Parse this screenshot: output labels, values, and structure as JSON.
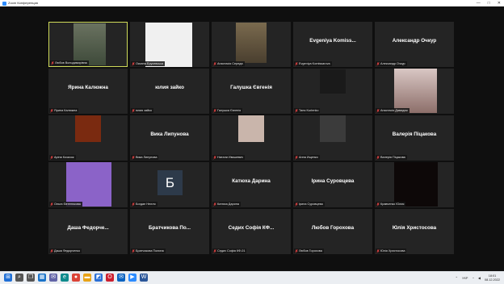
{
  "window": {
    "title": "Zoom Конференция",
    "controls": {
      "minimize": "—",
      "maximize": "□",
      "close": "✕"
    }
  },
  "tiles": [
    {
      "name": "",
      "label": "Любов Володимирівна",
      "speaking": true,
      "photo": "lyubov"
    },
    {
      "name": "",
      "label": "Оксана Ерусевська",
      "photo": "oksana"
    },
    {
      "name": "",
      "label": "Анастасія Середа",
      "photo": "anastasia1"
    },
    {
      "name": "Evgeniya Komiss...",
      "label": "Evgeniya Komissarova"
    },
    {
      "name": "Александр Очкур",
      "label": "Александр Очкур"
    },
    {
      "name": "Ярина Калюжна",
      "label": "Ярина Калюжна"
    },
    {
      "name": "юлия зайко",
      "label": "юлия зайко"
    },
    {
      "name": "Галушка Євгенія",
      "label": "Галушка Євгенія"
    },
    {
      "name": "",
      "label": "Таня Kurlenko",
      "photo": "tania"
    },
    {
      "name": "",
      "label": "Анастасія Давидюк",
      "photo": "anastasia2"
    },
    {
      "name": "",
      "label": "Аріна Козачок",
      "photo": "arina"
    },
    {
      "name": "Вика Липунова",
      "label": "Вика Липунова"
    },
    {
      "name": "",
      "label": "Натали Ивашевич",
      "photo": "natali"
    },
    {
      "name": "",
      "label": "Анна Ищенко",
      "photo": "anna"
    },
    {
      "name": "Валерія Піцакова",
      "label": "Валерія Піцакова"
    },
    {
      "name": "",
      "label": "Ольга Євтенюкова",
      "photo": "olga"
    },
    {
      "name": "",
      "label": "Богдан Нелля",
      "avatar": "Б"
    },
    {
      "name": "Катюха Дарина",
      "label": "Катюха Дарина"
    },
    {
      "name": "Ірина Суровцева",
      "label": "Ірина Суровцева"
    },
    {
      "name": "",
      "label": "Кравченко Юлия",
      "photo": "kravchenko"
    },
    {
      "name": "Даша Федорче...",
      "label": "Даша Федорченко"
    },
    {
      "name": "Братчикова По...",
      "label": "Братчикова Полина"
    },
    {
      "name": "Седих Софія КФ...",
      "label": "Седих Софія КФ-01"
    },
    {
      "name": "Любов Горохова",
      "label": "Любов Горохова"
    },
    {
      "name": "Юлія Христосова",
      "label": "Юлія Христосова"
    }
  ],
  "taskbar": {
    "icons": [
      {
        "name": "windows-start-icon",
        "glyph": "⊞",
        "color": "#1f6fd6"
      },
      {
        "name": "search-icon",
        "glyph": "⌕",
        "color": "#555555"
      },
      {
        "name": "task-view-icon",
        "glyph": "❐",
        "color": "#555555"
      },
      {
        "name": "widgets-icon",
        "glyph": "▦",
        "color": "#1a73c9"
      },
      {
        "name": "chat-icon",
        "glyph": "✉",
        "color": "#6264a7"
      },
      {
        "name": "edge-icon",
        "glyph": "e",
        "color": "#0f8b8d"
      },
      {
        "name": "chrome-icon",
        "glyph": "●",
        "color": "#db4437"
      },
      {
        "name": "explorer-icon",
        "glyph": "▬",
        "color": "#e8a317"
      },
      {
        "name": "store-icon",
        "glyph": "◩",
        "color": "#2a6fd6"
      },
      {
        "name": "opera-icon",
        "glyph": "O",
        "color": "#cc1f2f"
      },
      {
        "name": "mail-icon",
        "glyph": "✉",
        "color": "#0b63c1"
      },
      {
        "name": "zoom-icon",
        "glyph": "▶",
        "color": "#2d8cff"
      },
      {
        "name": "word-icon",
        "glyph": "W",
        "color": "#2b579a"
      }
    ],
    "tray": {
      "language": "УКР",
      "time": "18:01",
      "date": "08.12.2022"
    }
  }
}
